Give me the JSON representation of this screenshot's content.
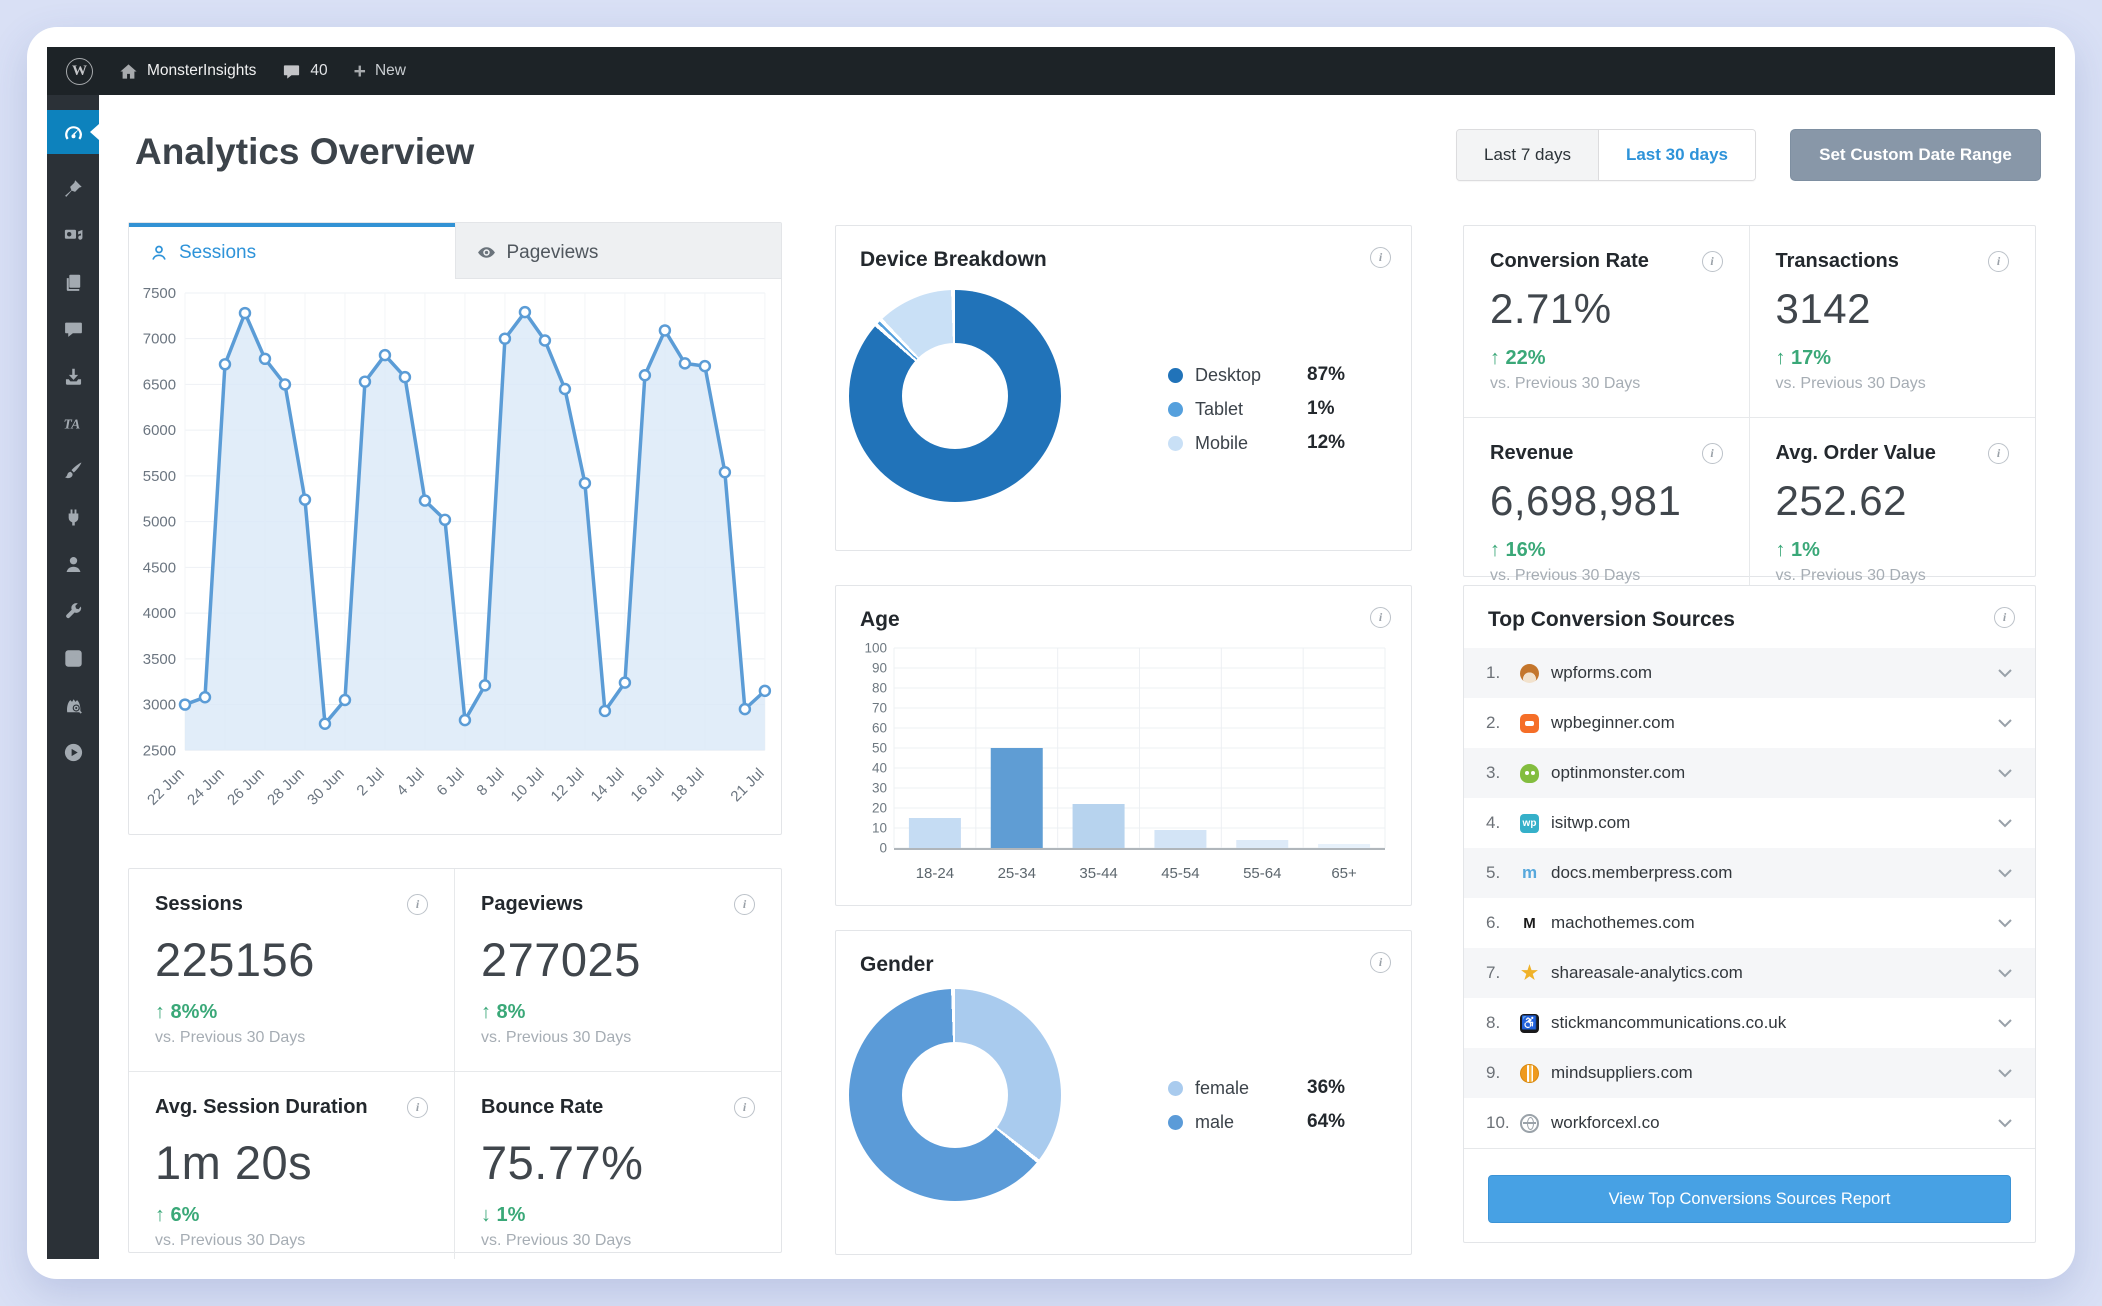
{
  "colors": {
    "accent_blue": "#2e93d9",
    "green_delta": "#3aa878",
    "sidebar_active_blue": "#0d82bd",
    "report_button_blue": "#47a1e4",
    "custom_range_button": "#8897a8",
    "line_blue": "#5b9cd6",
    "donut_dark_blue": "#2173b9",
    "donut_mid_blue": "#55a0dd",
    "donut_light_blue": "#c9e0f6"
  },
  "admin_bar": {
    "site_name": "MonsterInsights",
    "comment_count": "40",
    "plus_glyph": "+",
    "new_label": "New"
  },
  "sidebar": {
    "items": [
      {
        "name": "dashboard",
        "icon": "gauge",
        "active": true
      },
      {
        "name": "posts",
        "icon": "pin",
        "active": false
      },
      {
        "name": "media",
        "icon": "media",
        "active": false
      },
      {
        "name": "pages",
        "icon": "pages",
        "active": false
      },
      {
        "name": "comments",
        "icon": "comments",
        "active": false
      },
      {
        "name": "downloads",
        "icon": "download",
        "active": false
      },
      {
        "name": "ta",
        "icon": "ta",
        "active": false
      },
      {
        "name": "appearance",
        "icon": "brush",
        "active": false
      },
      {
        "name": "plugins",
        "icon": "plug",
        "active": false
      },
      {
        "name": "users",
        "icon": "user",
        "active": false
      },
      {
        "name": "tools",
        "icon": "wrench",
        "active": false
      },
      {
        "name": "settings",
        "icon": "sliders",
        "active": false
      },
      {
        "name": "monsterinsights",
        "icon": "monster",
        "active": false
      },
      {
        "name": "video",
        "icon": "play",
        "active": false
      }
    ]
  },
  "header": {
    "title": "Analytics Overview",
    "ranges": [
      "Last 7 days",
      "Last 30 days"
    ],
    "active_range": "Last 30 days",
    "custom_range_label": "Set Custom Date Range"
  },
  "traffic": {
    "tabs": [
      "Sessions",
      "Pageviews"
    ]
  },
  "chart_data": [
    {
      "id": "sessions",
      "type": "line",
      "title": "Sessions",
      "values": [
        3000,
        3080,
        6720,
        7280,
        6780,
        6500,
        5240,
        2790,
        3050,
        6530,
        6820,
        6580,
        5230,
        5020,
        2830,
        3210,
        7000,
        7290,
        6980,
        6450,
        5420,
        2930,
        3240,
        6600,
        7090,
        6730,
        6700,
        5540,
        2950,
        3150
      ],
      "xtick_labels": [
        "22 Jun",
        "24 Jun",
        "26 Jun",
        "28 Jun",
        "30 Jun",
        "2 Jul",
        "4 Jul",
        "6 Jul",
        "8 Jul",
        "10 Jul",
        "12 Jul",
        "14 Jul",
        "16 Jul",
        "18 Jul",
        "21 Jul"
      ],
      "xtick_indices": [
        0,
        2,
        4,
        6,
        8,
        10,
        12,
        14,
        16,
        18,
        20,
        22,
        24,
        26,
        29
      ],
      "ylim": [
        2500,
        7500
      ],
      "ytick_step": 500,
      "grid": true,
      "legend_position": "none"
    },
    {
      "id": "device",
      "type": "donut",
      "title": "Device Breakdown",
      "labels": [
        "Desktop",
        "Tablet",
        "Mobile"
      ],
      "values": [
        87,
        1,
        12
      ],
      "colors": [
        "#2173b9",
        "#55a0dd",
        "#c9e0f6"
      ],
      "legend_position": "right"
    },
    {
      "id": "age",
      "type": "bar",
      "title": "Age",
      "categories": [
        "18-24",
        "25-34",
        "35-44",
        "45-54",
        "55-64",
        "65+"
      ],
      "values": [
        15,
        50,
        22,
        9,
        4,
        2
      ],
      "colors": [
        "#c5dcf3",
        "#5f9dd4",
        "#b7d3ee",
        "#d3e4f6",
        "#ddeaf8",
        "#e7f1fb"
      ],
      "ylim": [
        0,
        100
      ],
      "ytick_step": 10,
      "grid": true,
      "legend_position": "none"
    },
    {
      "id": "gender",
      "type": "donut",
      "title": "Gender",
      "labels": [
        "female",
        "male"
      ],
      "values": [
        36,
        64
      ],
      "colors": [
        "#a9cbee",
        "#5b9bd8"
      ],
      "legend_position": "right"
    }
  ],
  "left_stats": [
    {
      "title": "Sessions",
      "value": "225156",
      "dir": "up",
      "delta": "8%%",
      "sub": "vs. Previous 30 Days"
    },
    {
      "title": "Pageviews",
      "value": "277025",
      "dir": "up",
      "delta": "8%",
      "sub": "vs. Previous 30 Days"
    },
    {
      "title": "Avg. Session Duration",
      "value": "1m 20s",
      "dir": "up",
      "delta": "6%",
      "sub": "vs. Previous 30 Days"
    },
    {
      "title": "Bounce Rate",
      "value": "75.77%",
      "dir": "down",
      "delta": "1%",
      "sub": "vs. Previous 30 Days"
    }
  ],
  "right_stats": [
    {
      "title": "Conversion Rate",
      "value": "2.71%",
      "dir": "up",
      "delta": "22%",
      "sub": "vs. Previous 30 Days"
    },
    {
      "title": "Transactions",
      "value": "3142",
      "dir": "up",
      "delta": "17%",
      "sub": "vs. Previous 30 Days"
    },
    {
      "title": "Revenue",
      "value": "6,698,981",
      "dir": "up",
      "delta": "16%",
      "sub": "vs. Previous 30 Days"
    },
    {
      "title": "Avg. Order Value",
      "value": "252.62",
      "dir": "up",
      "delta": "1%",
      "sub": "vs. Previous 30 Days"
    }
  ],
  "sources": {
    "title": "Top Conversion Sources",
    "button_label": "View Top Conversions Sources Report",
    "items": [
      {
        "rank": "1.",
        "domain": "wpforms.com",
        "icon": "teddy-bear",
        "glyph": ""
      },
      {
        "rank": "2.",
        "domain": "wpbeginner.com",
        "icon": "chat-bubble",
        "glyph": ""
      },
      {
        "rank": "3.",
        "domain": "optinmonster.com",
        "icon": "monster-face",
        "glyph": ""
      },
      {
        "rank": "4.",
        "domain": "isitwp.com",
        "icon": "wp-square",
        "glyph": "wp"
      },
      {
        "rank": "5.",
        "domain": "docs.memberpress.com",
        "icon": "letter-m-blue",
        "glyph": "m"
      },
      {
        "rank": "6.",
        "domain": "machothemes.com",
        "icon": "letter-m-black",
        "glyph": "M"
      },
      {
        "rank": "7.",
        "domain": "shareasale-analytics.com",
        "icon": "gold-star",
        "glyph": "★"
      },
      {
        "rank": "8.",
        "domain": "stickmancommunications.co.uk",
        "icon": "accessibility-black",
        "glyph": "♿"
      },
      {
        "rank": "9.",
        "domain": "mindsuppliers.com",
        "icon": "orange-striped-circle",
        "glyph": ""
      },
      {
        "rank": "10.",
        "domain": "workforcexl.co",
        "icon": "gray-globe",
        "glyph": ""
      }
    ]
  }
}
